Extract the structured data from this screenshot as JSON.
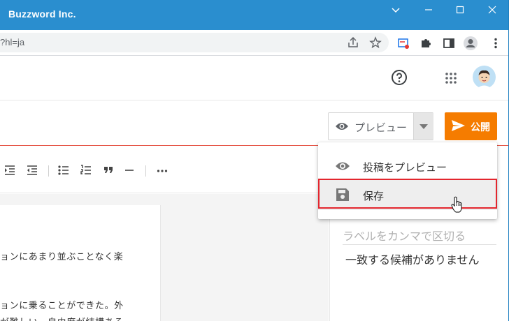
{
  "window": {
    "title": "Buzzword Inc."
  },
  "address_bar": {
    "url_fragment": "?hl=ja"
  },
  "editor": {
    "preview_button_label": "プレビュー",
    "publish_button_label": "公開",
    "body_lines": [
      "ョンにあまり並ぶことなく楽",
      "ョンに乗ることができた。外",
      "が難しい　自由度が結構ある"
    ]
  },
  "dropdown": {
    "items": [
      {
        "label": "投稿をプレビュー",
        "icon": "eye-icon"
      },
      {
        "label": "保存",
        "icon": "save-icon"
      }
    ]
  },
  "labels_panel": {
    "placeholder": "ラベルをカンマで区切る",
    "no_match_text": "一致する候補がありません"
  },
  "colors": {
    "titlebar": "#2a8ecf",
    "publish": "#f57c00",
    "highlight_border": "#e3262e"
  }
}
